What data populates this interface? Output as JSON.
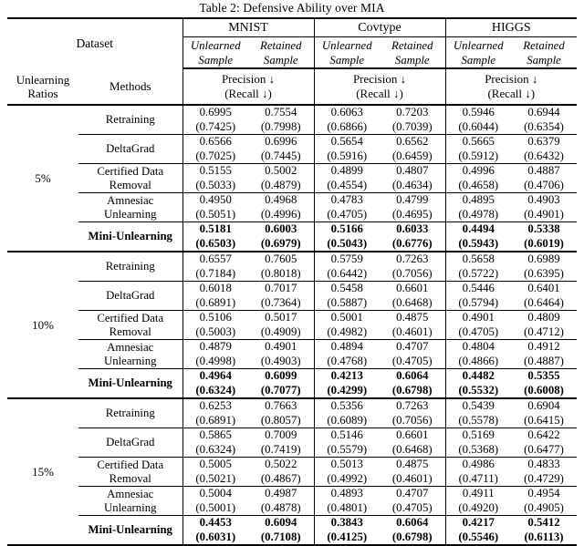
{
  "caption": "Table 2: Defensive Ability over MIA",
  "header": {
    "dataset_label": "Dataset",
    "ratios_label_line1": "Unlearning",
    "ratios_label_line2": "Ratios",
    "methods_label": "Methods",
    "datasets": [
      "MNIST",
      "Covtype",
      "HIGGS"
    ],
    "sample_unlearned_line1": "Unlearned",
    "sample_unlearned_line2": "Sample",
    "sample_retained_line1": "Retained",
    "sample_retained_line2": "Sample",
    "metric_line1": "Precision ↓",
    "metric_line2": "(Recall ↓)"
  },
  "chart_data": {
    "type": "table",
    "title": "Table 2: Defensive Ability over MIA",
    "column_groups": [
      "MNIST",
      "Covtype",
      "HIGGS"
    ],
    "sub_columns": [
      "Unlearned Sample",
      "Retained Sample"
    ],
    "cell_format": "Precision (Recall)",
    "row_groups": [
      {
        "ratio": "5%",
        "rows": [
          {
            "method": "Retraining",
            "bold": false,
            "values": [
              "0.6995",
              "0.7554",
              "0.6063",
              "0.7203",
              "0.5946",
              "0.6944"
            ],
            "recalls": [
              "(0.7425)",
              "(0.7998)",
              "(0.6866)",
              "(0.7039)",
              "(0.6044)",
              "(0.6354)"
            ]
          },
          {
            "method": "DeltaGrad",
            "bold": false,
            "values": [
              "0.6566",
              "0.6996",
              "0.5654",
              "0.6562",
              "0.5665",
              "0.6379"
            ],
            "recalls": [
              "(0.7025)",
              "(0.7445)",
              "(0.5916)",
              "(0.6459)",
              "(0.5912)",
              "(0.6432)"
            ]
          },
          {
            "method": "Certified Data Removal",
            "method_l1": "Certified Data",
            "method_l2": "Removal",
            "bold": false,
            "values": [
              "0.5155",
              "0.5002",
              "0.4899",
              "0.4807",
              "0.4996",
              "0.4887"
            ],
            "recalls": [
              "(0.5033)",
              "(0.4879)",
              "(0.4554)",
              "(0.4634)",
              "(0.4658)",
              "(0.4706)"
            ]
          },
          {
            "method": "Amnesiac Unlearning",
            "method_l1": "Amnesiac",
            "method_l2": "Unlearning",
            "bold": false,
            "values": [
              "0.4950",
              "0.4968",
              "0.4783",
              "0.4799",
              "0.4895",
              "0.4903"
            ],
            "recalls": [
              "(0.5051)",
              "(0.4996)",
              "(0.4705)",
              "(0.4695)",
              "(0.4978)",
              "(0.4901)"
            ]
          },
          {
            "method": "Mini-Unlearning",
            "bold": true,
            "values": [
              "0.5181",
              "0.6003",
              "0.5166",
              "0.6033",
              "0.4494",
              "0.5338"
            ],
            "recalls": [
              "(0.6503)",
              "(0.6979)",
              "(0.5043)",
              "(0.6776)",
              "(0.5943)",
              "(0.6019)"
            ]
          }
        ]
      },
      {
        "ratio": "10%",
        "rows": [
          {
            "method": "Retraining",
            "bold": false,
            "values": [
              "0.6557",
              "0.7605",
              "0.5759",
              "0.7263",
              "0.5658",
              "0.6989"
            ],
            "recalls": [
              "(0.7184)",
              "(0.8018)",
              "(0.6442)",
              "(0.7056)",
              "(0.5722)",
              "(0.6395)"
            ]
          },
          {
            "method": "DeltaGrad",
            "bold": false,
            "values": [
              "0.6018",
              "0.7017",
              "0.5458",
              "0.6601",
              "0.5446",
              "0.6401"
            ],
            "recalls": [
              "(0.6891)",
              "(0.7364)",
              "(0.5887)",
              "(0.6468)",
              "(0.5794)",
              "(0.6464)"
            ]
          },
          {
            "method": "Certified Data Removal",
            "method_l1": "Certified Data",
            "method_l2": "Removal",
            "bold": false,
            "values": [
              "0.5106",
              "0.5017",
              "0.5001",
              "0.4875",
              "0.4901",
              "0.4809"
            ],
            "recalls": [
              "(0.5003)",
              "(0.4909)",
              "(0.4982)",
              "(0.4601)",
              "(0.4705)",
              "(0.4712)"
            ]
          },
          {
            "method": "Amnesiac Unlearning",
            "method_l1": "Amnesiac",
            "method_l2": "Unlearning",
            "bold": false,
            "values": [
              "0.4879",
              "0.4901",
              "0.4894",
              "0.4707",
              "0.4804",
              "0.4912"
            ],
            "recalls": [
              "(0.4998)",
              "(0.4903)",
              "(0.4768)",
              "(0.4705)",
              "(0.4866)",
              "(0.4887)"
            ]
          },
          {
            "method": "Mini-Unlearning",
            "bold": true,
            "values": [
              "0.4964",
              "0.6099",
              "0.4213",
              "0.6064",
              "0.4482",
              "0.5355"
            ],
            "recalls": [
              "(0.6324)",
              "(0.7077)",
              "(0.4299)",
              "(0.6798)",
              "(0.5532)",
              "(0.6008)"
            ]
          }
        ]
      },
      {
        "ratio": "15%",
        "rows": [
          {
            "method": "Retraining",
            "bold": false,
            "values": [
              "0.6253",
              "0.7663",
              "0.5356",
              "0.7263",
              "0.5439",
              "0.6904"
            ],
            "recalls": [
              "(0.6891)",
              "(0.8057)",
              "(0.6089)",
              "(0.7056)",
              "(0.5578)",
              "(0.6415)"
            ]
          },
          {
            "method": "DeltaGrad",
            "bold": false,
            "values": [
              "0.5865",
              "0.7009",
              "0.5146",
              "0.6601",
              "0.5169",
              "0.6422"
            ],
            "recalls": [
              "(0.6324)",
              "(0.7419)",
              "(0.5579)",
              "(0.6468)",
              "(0.5368)",
              "(0.6477)"
            ]
          },
          {
            "method": "Certified Data Removal",
            "method_l1": "Certified Data",
            "method_l2": "Removal",
            "bold": false,
            "values": [
              "0.5005",
              "0.5022",
              "0.5013",
              "0.4875",
              "0.4986",
              "0.4833"
            ],
            "recalls": [
              "(0.5021)",
              "(0.4867)",
              "(0.4992)",
              "(0.4601)",
              "(0.4711)",
              "(0.4729)"
            ]
          },
          {
            "method": "Amnesiac Unlearning",
            "method_l1": "Amnesiac",
            "method_l2": "Unlearning",
            "bold": false,
            "values": [
              "0.5004",
              "0.4987",
              "0.4893",
              "0.4707",
              "0.4911",
              "0.4954"
            ],
            "recalls": [
              "(0.5001)",
              "(0.4878)",
              "(0.4801)",
              "(0.4705)",
              "(0.4920)",
              "(0.4905)"
            ]
          },
          {
            "method": "Mini-Unlearning",
            "bold": true,
            "values": [
              "0.4453",
              "0.6094",
              "0.3843",
              "0.6064",
              "0.4217",
              "0.5412"
            ],
            "recalls": [
              "(0.6031)",
              "(0.7108)",
              "(0.4125)",
              "(0.6798)",
              "(0.5546)",
              "(0.6113)"
            ]
          }
        ]
      }
    ]
  }
}
